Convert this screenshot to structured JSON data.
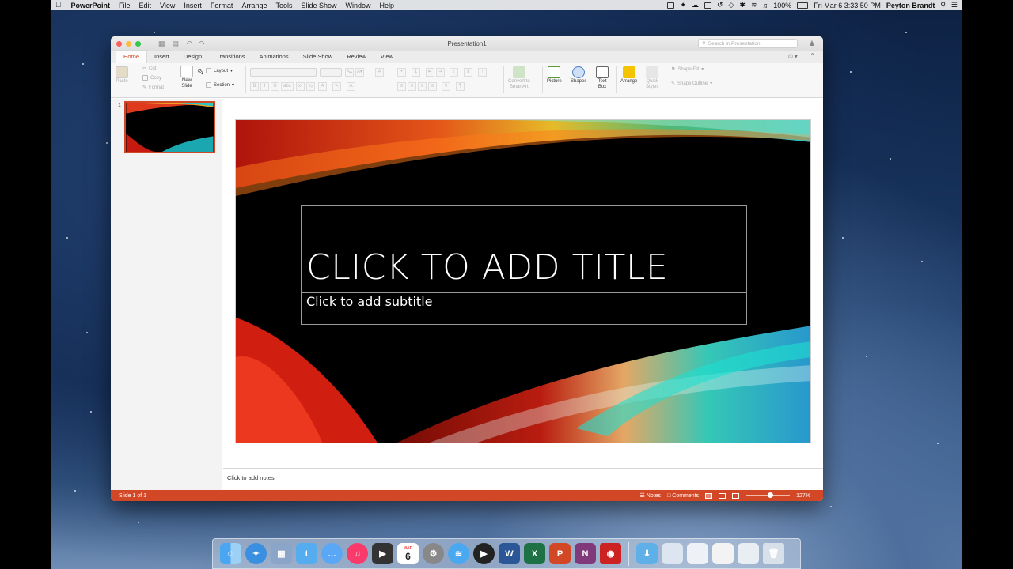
{
  "menubar": {
    "app_name": "PowerPoint",
    "items": [
      "File",
      "Edit",
      "View",
      "Insert",
      "Format",
      "Arrange",
      "Tools",
      "Slide Show",
      "Window",
      "Help"
    ],
    "battery": "100%",
    "datetime": "Fri Mar 6  3:33:50 PM",
    "user": "Peyton Brandt"
  },
  "window": {
    "title": "Presentation1",
    "search_placeholder": "Search in Presentation"
  },
  "tabs": [
    "Home",
    "Insert",
    "Design",
    "Transitions",
    "Animations",
    "Slide Show",
    "Review",
    "View"
  ],
  "ribbon": {
    "paste": "Paste",
    "cut": "Cut",
    "copy": "Copy",
    "format": "Format",
    "new_slide": "New\nSlide",
    "layout": "Layout",
    "section": "Section",
    "bold": "B",
    "italic": "I",
    "underline": "U",
    "strike": "abc",
    "convert_smartart": "Convert to\nSmartArt",
    "picture": "Picture",
    "shapes": "Shapes",
    "text_box": "Text\nBox",
    "arrange": "Arrange",
    "quick_styles": "Quick\nStyles",
    "shape_fill": "Shape Fill",
    "shape_outline": "Shape Outline"
  },
  "thumbnails": [
    {
      "number": "1"
    }
  ],
  "slide": {
    "title": "CLICK TO ADD TITLE",
    "subtitle": "Click to add subtitle"
  },
  "notes_placeholder": "Click to add notes",
  "statusbar": {
    "slide_count": "Slide 1 of 1",
    "notes": "Notes",
    "comments": "Comments",
    "zoom": "127%"
  },
  "dock": {
    "calendar_month": "MAR",
    "calendar_day": "6",
    "apps": [
      "Finder",
      "Safari",
      "Preview",
      "Twitter",
      "Messages",
      "iTunes",
      "Final Cut Pro",
      "Calendar",
      "System Preferences",
      "AirDrop",
      "QuickTime",
      "Word",
      "Excel",
      "PowerPoint",
      "OneNote",
      "Photo Booth",
      "Downloads",
      "Folder",
      "Document",
      "Document",
      "Document",
      "Trash"
    ]
  }
}
